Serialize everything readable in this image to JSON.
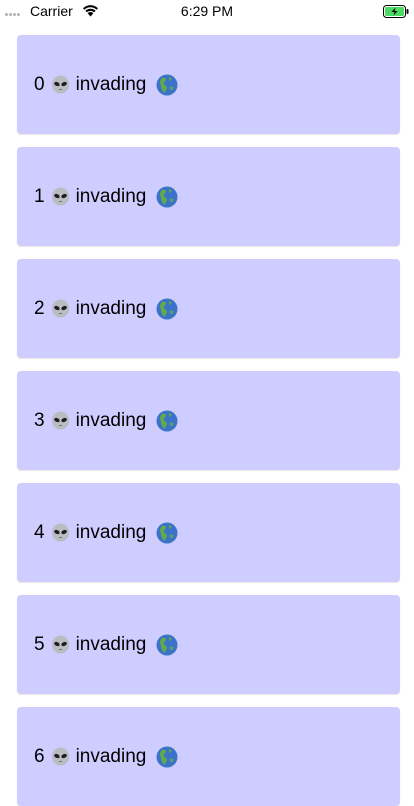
{
  "status_bar": {
    "carrier": "Carrier",
    "time": "6:29 PM",
    "icons": [
      "signal-dots",
      "wifi-icon",
      "battery-charging-icon"
    ]
  },
  "list": {
    "items": [
      {
        "index": "0",
        "label": "invading"
      },
      {
        "index": "1",
        "label": "invading"
      },
      {
        "index": "2",
        "label": "invading"
      },
      {
        "index": "3",
        "label": "invading"
      },
      {
        "index": "4",
        "label": "invading"
      },
      {
        "index": "5",
        "label": "invading"
      },
      {
        "index": "6",
        "label": "invading"
      }
    ],
    "item_icons": [
      "alien-icon",
      "earth-globe-americas-icon"
    ]
  },
  "colors": {
    "card_background": "#cfcdff",
    "page_background": "#ffffff",
    "battery_fill": "#4cd964"
  }
}
